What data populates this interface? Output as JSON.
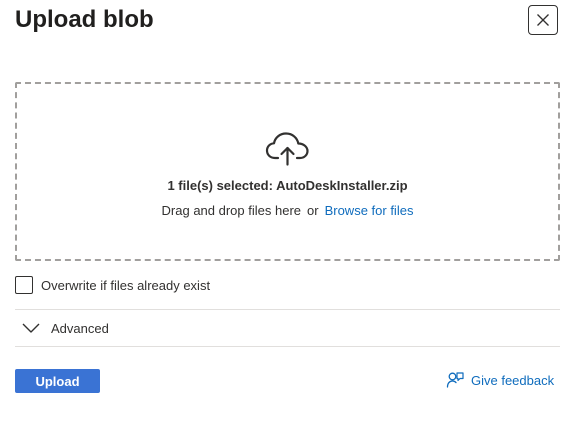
{
  "dialog": {
    "title": "Upload blob",
    "close_icon": "close-icon"
  },
  "dropzone": {
    "icon": "cloud-upload-icon",
    "selected_text": "1 file(s) selected: AutoDeskInstaller.zip",
    "drag_text": "Drag and drop files here",
    "or_text": "or",
    "browse_link": "Browse for files"
  },
  "options": {
    "overwrite_label": "Overwrite if files already exist",
    "overwrite_checked": false
  },
  "advanced": {
    "label": "Advanced",
    "icon": "chevron-down-icon",
    "expanded": false
  },
  "footer": {
    "upload_label": "Upload",
    "feedback_label": "Give feedback",
    "feedback_icon": "feedback-person-icon"
  },
  "colors": {
    "primary": "#3a73d4",
    "link": "#0f6cbd",
    "text": "#323130",
    "border_dashed": "#a19f9d",
    "divider": "#e1dfdd"
  }
}
